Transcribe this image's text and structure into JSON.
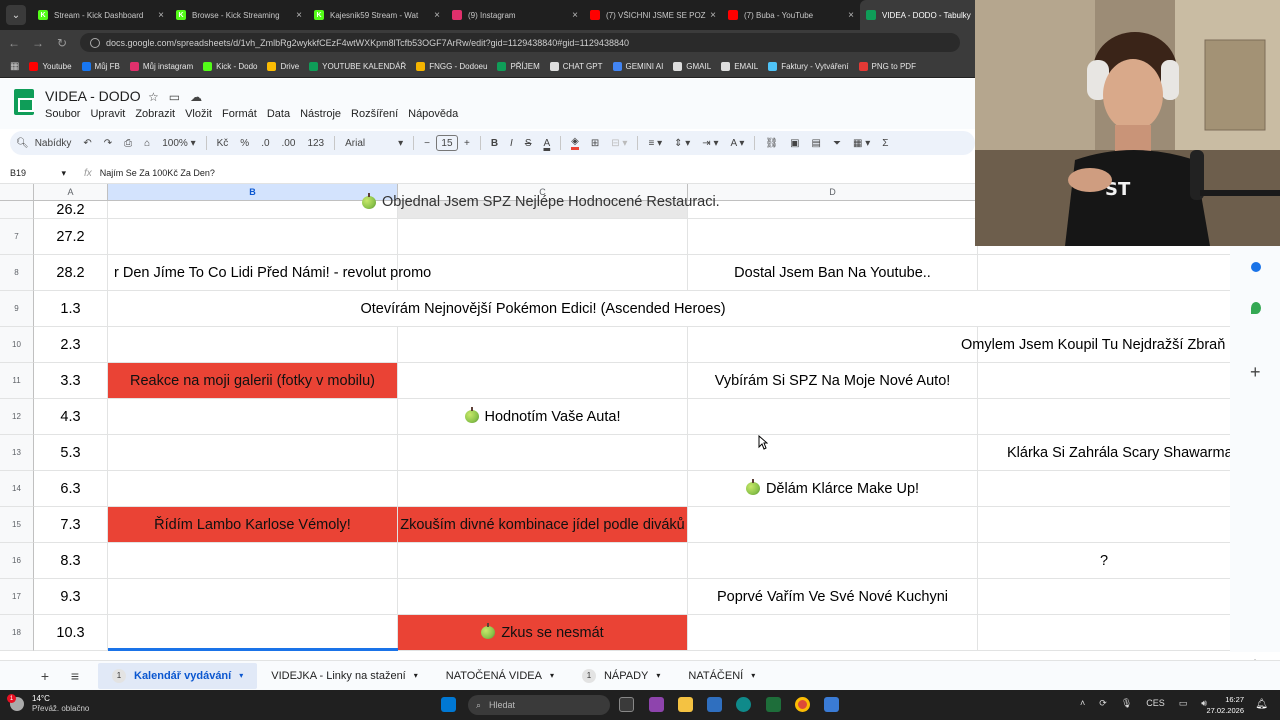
{
  "browser": {
    "tabs": [
      {
        "title": "Stream - Kick Dashboard",
        "favicon_color": "#53fc18",
        "favicon_letter": "K"
      },
      {
        "title": "Browse - Kick Streaming",
        "favicon_color": "#53fc18",
        "favicon_letter": "K"
      },
      {
        "title": "Kajesnik59 Stream - Wat",
        "favicon_color": "#53fc18",
        "favicon_letter": "K"
      },
      {
        "title": "(9) Instagram",
        "favicon_color": "#e1306c",
        "favicon_letter": ""
      },
      {
        "title": "(7) VŠICHNI JSME SE POZ",
        "favicon_color": "#ff0000",
        "favicon_letter": ""
      },
      {
        "title": "(7) Buba - YouTube",
        "favicon_color": "#ff0000",
        "favicon_letter": ""
      },
      {
        "title": "VIDEA - DODO - Tabulky",
        "favicon_color": "#0f9d58",
        "favicon_letter": "",
        "active": true
      }
    ],
    "url": "docs.google.com/spreadsheets/d/1vh_ZmlbRg2wykkfCEzF4wtWXKpm8lTcfb53OGF7ArRw/edit?gid=1129438840#gid=1129438840",
    "bookmarks": [
      {
        "label": "Youtube",
        "color": "#ff0000"
      },
      {
        "label": "Můj FB",
        "color": "#1877f2"
      },
      {
        "label": "Můj instagram",
        "color": "#e1306c"
      },
      {
        "label": "Kick - Dodo",
        "color": "#53fc18"
      },
      {
        "label": "Drive",
        "color": "#fbbc04"
      },
      {
        "label": "YOUTUBE KALENDÁŘ",
        "color": "#0f9d58"
      },
      {
        "label": "FNGG - Dodoeu",
        "color": "#f4b400"
      },
      {
        "label": "PŘÍJEM",
        "color": "#0f9d58"
      },
      {
        "label": "CHAT GPT",
        "color": "#dddddd"
      },
      {
        "label": "GEMINI AI",
        "color": "#4285f4"
      },
      {
        "label": "GMAIL",
        "color": "#dddddd"
      },
      {
        "label": "EMAIL",
        "color": "#dddddd"
      },
      {
        "label": "Faktury - Vytváření",
        "color": "#4fc3f7"
      },
      {
        "label": "PNG to PDF",
        "color": "#e53935"
      }
    ]
  },
  "sheets": {
    "doc_title": "VIDEA - DODO",
    "menu": [
      "Soubor",
      "Upravit",
      "Zobrazit",
      "Vložit",
      "Formát",
      "Data",
      "Nástroje",
      "Rozšíření",
      "Nápověda"
    ],
    "toolbar": {
      "search_label": "Nabídky",
      "zoom": "100%",
      "currency": "Kč",
      "percent": "%",
      "dec_minus": ".0",
      "dec_plus": ".00",
      "format_123": "123",
      "font": "Arial",
      "font_size": "15",
      "bold": "B",
      "italic": "I",
      "strike": "S",
      "text_color": "A"
    },
    "name_box": "B19",
    "formula_value": "Najím Se Za 100Kč Za Den?",
    "columns": [
      "A",
      "B",
      "C",
      "D"
    ],
    "rows": [
      {
        "num": "",
        "date": "26.2",
        "c_over": "Objednal Jsem SPZ Nejlépe Hodnocené Restauraci."
      },
      {
        "num": "7",
        "date": "27.2"
      },
      {
        "num": "8",
        "date": "28.2",
        "b_over": "r Den Jíme To Co Lidi Před Námi! - revolut promo",
        "d": "Dostal Jsem Ban Na Youtube.."
      },
      {
        "num": "9",
        "date": "1.3",
        "c_over": "Otevírám Nejnovější Pokémon Edici! (Ascended Heroes)"
      },
      {
        "num": "10",
        "date": "2.3",
        "e_over": "Omylem Jsem Koupil Tu Nejdražší Zbraň"
      },
      {
        "num": "11",
        "date": "3.3",
        "b": "Reakce na moji galerii (fotky v mobilu)",
        "d": "Vybírám Si SPZ Na Moje Nové Auto!"
      },
      {
        "num": "12",
        "date": "4.3",
        "c": "Hodnotím Vaše Auta!"
      },
      {
        "num": "13",
        "date": "5.3",
        "e_over": "Klárka Si Zahrála Scary Shawarma"
      },
      {
        "num": "14",
        "date": "6.3",
        "d": "Dělám Klárce Make Up!"
      },
      {
        "num": "15",
        "date": "7.3",
        "b": "Řídím Lambo Karlose Vémoly!",
        "c": "Zkouším divné kombinace jídel podle diváků"
      },
      {
        "num": "16",
        "date": "8.3",
        "e": "?"
      },
      {
        "num": "17",
        "date": "9.3",
        "d": "Poprvé Vařím Ve Své Nové Kuchyni"
      },
      {
        "num": "18",
        "date": "10.3",
        "c": "Zkus se nesmát"
      }
    ],
    "sheet_tabs": [
      {
        "label": "Kalendář vydávání",
        "badge": "1",
        "active": true
      },
      {
        "label": "VIDEJKA - Linky na stažení",
        "badge": ""
      },
      {
        "label": "NATOČENÁ VIDEA",
        "badge": ""
      },
      {
        "label": "NÁPADY",
        "badge": "1"
      },
      {
        "label": "NATÁČENÍ",
        "badge": ""
      }
    ],
    "highlight_color": "#ea4335"
  },
  "taskbar": {
    "weather_temp": "14°C",
    "weather_desc": "Převáž. oblačno",
    "notif_count": "1",
    "search_placeholder": "Hledat",
    "lang": "CES",
    "time": "16:27",
    "date": "27.02.2026"
  }
}
